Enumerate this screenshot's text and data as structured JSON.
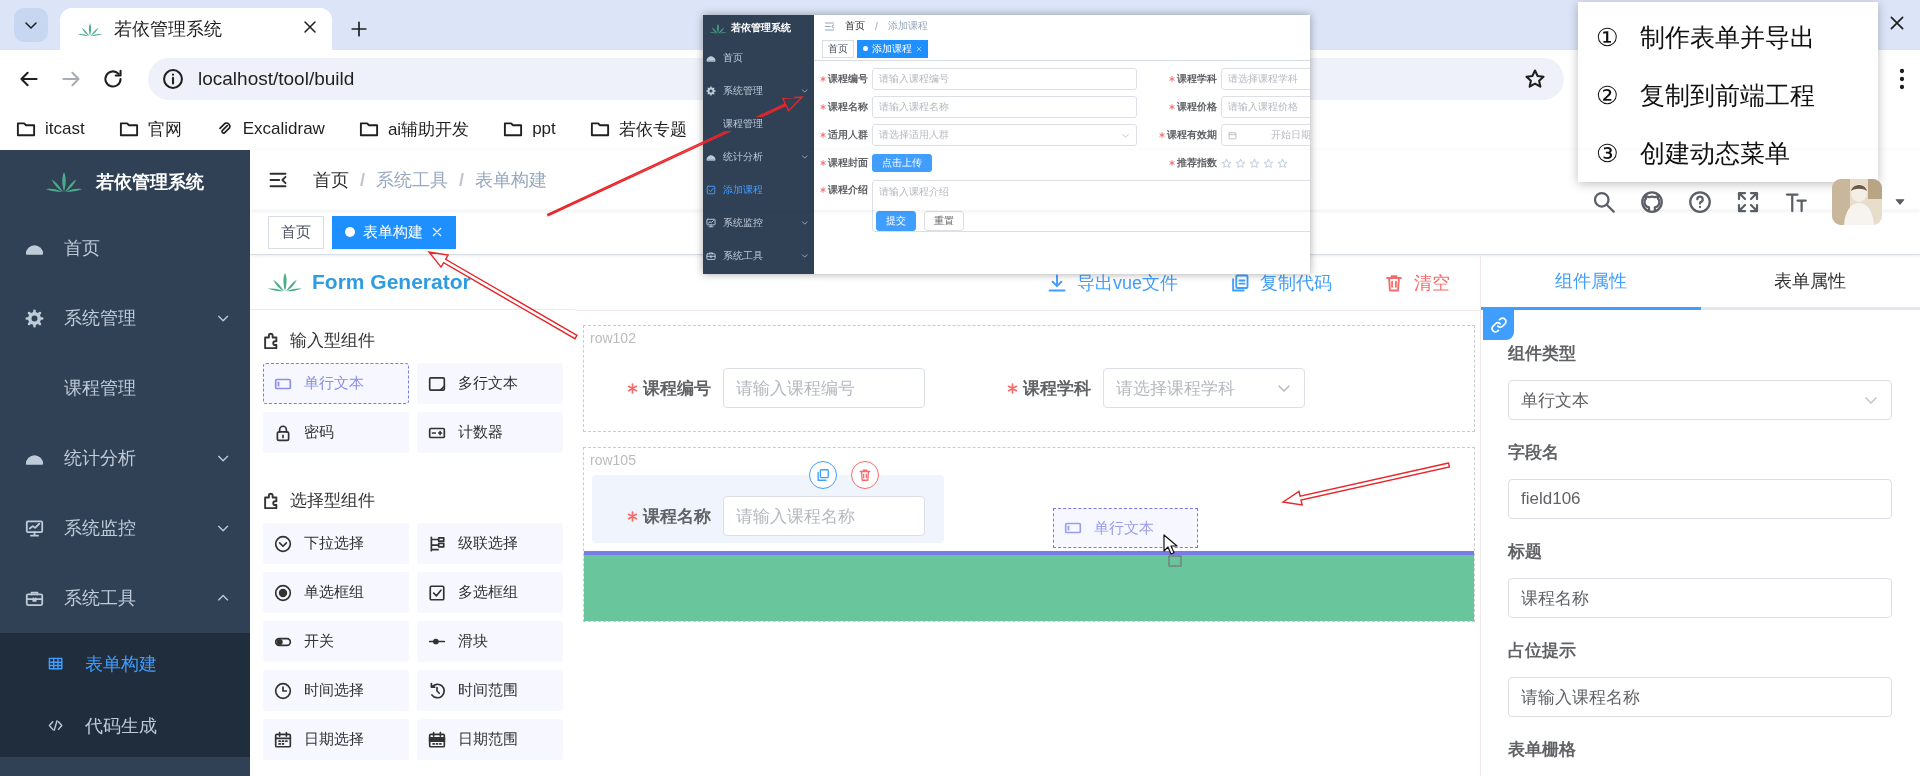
{
  "browser": {
    "tab_title": "若依管理系统",
    "url": "localhost/tool/build",
    "forward_disabled": true,
    "bookmarks": [
      {
        "label": "itcast",
        "kind": "folder"
      },
      {
        "label": "官网",
        "kind": "folder"
      },
      {
        "label": "Excalidraw",
        "kind": "clip"
      },
      {
        "label": "ai辅助开发",
        "kind": "folder"
      },
      {
        "label": "ppt",
        "kind": "folder"
      },
      {
        "label": "若依专题",
        "kind": "folder"
      }
    ]
  },
  "sidebar": {
    "title": "若依管理系统",
    "items": [
      {
        "label": "首页",
        "selected": false
      },
      {
        "label": "系统管理",
        "selected": false,
        "expanded": false
      },
      {
        "label": "课程管理",
        "selected": false
      },
      {
        "label": "统计分析",
        "selected": false,
        "expanded": false
      },
      {
        "label": "系统监控",
        "selected": false,
        "expanded": false
      },
      {
        "label": "系统工具",
        "selected": false,
        "expanded": true,
        "children": [
          {
            "label": "表单构建",
            "selected": true
          },
          {
            "label": "代码生成",
            "selected": false
          }
        ]
      }
    ]
  },
  "navbar": {
    "breadcrumb": [
      "首页",
      "系统工具",
      "表单构建"
    ],
    "separator": "/"
  },
  "tags": [
    {
      "label": "首页",
      "selected": false
    },
    {
      "label": "表单构建",
      "selected": true
    }
  ],
  "palette": {
    "title": "Form Generator",
    "groups": [
      {
        "title": "输入型组件",
        "items": [
          {
            "label": "单行文本",
            "dragging": true
          },
          {
            "label": "多行文本",
            "dragging": false
          },
          {
            "label": "密码",
            "dragging": false
          },
          {
            "label": "计数器",
            "dragging": false
          }
        ]
      },
      {
        "title": "选择型组件",
        "items": [
          {
            "label": "下拉选择",
            "dragging": false
          },
          {
            "label": "级联选择",
            "dragging": false
          },
          {
            "label": "单选框组",
            "dragging": false
          },
          {
            "label": "多选框组",
            "dragging": false
          },
          {
            "label": "开关",
            "dragging": false
          },
          {
            "label": "滑块",
            "dragging": false
          },
          {
            "label": "时间选择",
            "dragging": false
          },
          {
            "label": "时间范围",
            "dragging": false
          },
          {
            "label": "日期选择",
            "dragging": false
          },
          {
            "label": "日期范围",
            "dragging": false
          }
        ]
      }
    ]
  },
  "canvas": {
    "toolbar": [
      {
        "label": "导出vue文件",
        "kind": "export"
      },
      {
        "label": "复制代码",
        "kind": "copy"
      },
      {
        "label": "清空",
        "kind": "clear"
      }
    ],
    "rows": [
      {
        "name": "row102",
        "drop_zone": false,
        "fields": [
          {
            "label": "课程编号",
            "required": true,
            "kind": "input",
            "placeholder": "请输入课程编号",
            "active": false
          },
          {
            "label": "课程学科",
            "required": true,
            "kind": "select",
            "placeholder": "请选择课程学科",
            "active": false
          }
        ]
      },
      {
        "name": "row105",
        "drop_zone": true,
        "fields": [
          {
            "label": "课程名称",
            "required": true,
            "kind": "input",
            "placeholder": "请输入课程名称",
            "active": true
          }
        ]
      }
    ],
    "drag_ghost": {
      "label": "单行文本"
    }
  },
  "properties": {
    "tabs": [
      {
        "label": "组件属性",
        "selected": true
      },
      {
        "label": "表单属性",
        "selected": false
      }
    ],
    "fields": [
      {
        "label": "组件类型",
        "kind": "select",
        "value": "单行文本"
      },
      {
        "label": "字段名",
        "kind": "input",
        "value": "field106"
      },
      {
        "label": "标题",
        "kind": "input",
        "value": "课程名称"
      },
      {
        "label": "占位提示",
        "kind": "input",
        "value": "请输入课程名称"
      },
      {
        "label": "表单栅格"
      }
    ]
  },
  "inset": {
    "sidebar": {
      "title": "若依管理系统",
      "items": [
        {
          "label": "首页",
          "selected": false
        },
        {
          "label": "系统管理",
          "selected": false,
          "expanded": false
        },
        {
          "label": "课程管理",
          "selected": false
        },
        {
          "label": "统计分析",
          "selected": false,
          "expanded": false
        },
        {
          "label": "添加课程",
          "selected": true
        },
        {
          "label": "系统监控",
          "selected": false,
          "expanded": false
        },
        {
          "label": "系统工具",
          "selected": false,
          "expanded": false
        }
      ]
    },
    "breadcrumb": [
      "首页",
      "添加课程"
    ],
    "separator": "/",
    "tags": [
      {
        "label": "首页",
        "selected": false
      },
      {
        "label": "添加课程",
        "selected": true
      }
    ],
    "fields": [
      {
        "label": "课程编号",
        "required": true,
        "kind": "input",
        "placeholder": "请输入课程编号"
      },
      {
        "label": "课程学科",
        "required": true,
        "kind": "input",
        "placeholder": "请选择课程学科"
      },
      {
        "label": "课程名称",
        "required": true,
        "kind": "input",
        "placeholder": "请输入课程名称"
      },
      {
        "label": "课程价格",
        "required": true,
        "kind": "input",
        "placeholder": "请输入课程价格"
      },
      {
        "label": "适用人群",
        "required": true,
        "kind": "select",
        "placeholder": "请选择适用人群"
      },
      {
        "label": "课程有效期",
        "required": true,
        "kind": "date",
        "placeholder": "开始日期"
      },
      {
        "label": "课程封面",
        "required": true,
        "kind": "upload",
        "button": "点击上传"
      },
      {
        "label": "推荐指数",
        "required": true,
        "kind": "rate",
        "stars": 0
      },
      {
        "label": "课程介绍",
        "required": true,
        "kind": "textarea",
        "placeholder": "请输入课程介绍"
      }
    ],
    "buttons": [
      {
        "label": "提交",
        "kind": "primary"
      },
      {
        "label": "重置",
        "kind": "default"
      }
    ]
  },
  "callout": {
    "items": [
      {
        "number": "①",
        "text": "制作表单并导出"
      },
      {
        "number": "②",
        "text": "复制到前端工程"
      },
      {
        "number": "③",
        "text": "创建动态菜单"
      }
    ]
  }
}
